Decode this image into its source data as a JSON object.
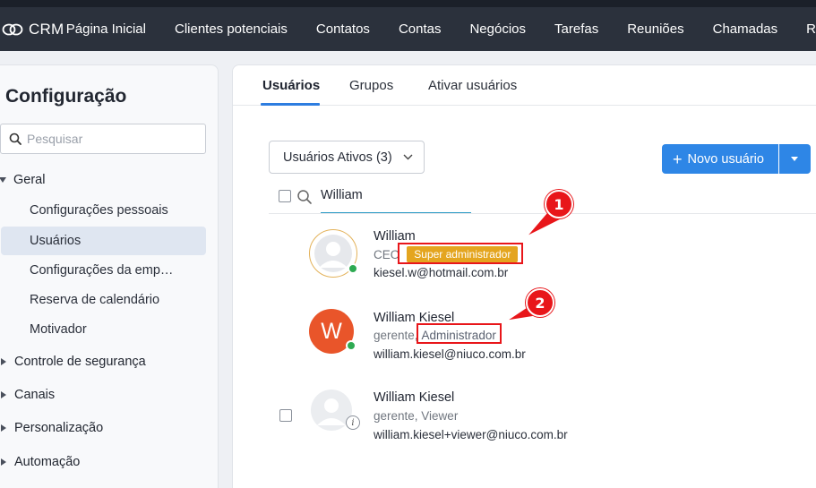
{
  "app": {
    "brand": "CRM"
  },
  "nav": {
    "items": [
      "Página Inicial",
      "Clientes potenciais",
      "Contatos",
      "Contas",
      "Negócios",
      "Tarefas",
      "Reuniões",
      "Chamadas",
      "R"
    ]
  },
  "sidebar": {
    "title": "Configuração",
    "search_placeholder": "Pesquisar",
    "general_label": "Geral",
    "general_items": [
      "Configurações pessoais",
      "Usuários",
      "Configurações da emp…",
      "Reserva de calendário",
      "Motivador"
    ],
    "active_item": "Usuários",
    "groups": [
      "Controle de segurança",
      "Canais",
      "Personalização",
      "Automação"
    ]
  },
  "tabs": [
    "Usuários",
    "Grupos",
    "Ativar usuários"
  ],
  "toolbar": {
    "filter_label": "Usuários Ativos (3)",
    "new_user_label": "Novo usuário",
    "search_value": "William"
  },
  "users": [
    {
      "name": "William",
      "role": "CEO",
      "badge": "Super administrador",
      "email": "kiesel.w@hotmail.com.br",
      "status": "online"
    },
    {
      "name": "William Kiesel",
      "role": "gerente,",
      "badge": "Administrador",
      "email": "william.kiesel@niuco.com.br",
      "initial": "W",
      "status": "online"
    },
    {
      "name": "William Kiesel",
      "role": "gerente, Viewer",
      "email": "william.kiesel+viewer@niuco.com.br",
      "status": "info"
    }
  ],
  "callouts": [
    "1",
    "2"
  ],
  "colors": {
    "nav_bg": "#2b313c",
    "accent_blue": "#2e86e6",
    "super_admin_badge": "#e4a51f",
    "avatar_orange": "#e9552a",
    "online_green": "#2eaa52",
    "annotation_red": "#e8161a"
  },
  "icons": [
    "crm-logo-icon",
    "search-icon",
    "chevron-down-icon",
    "caret-down-icon",
    "caret-right-icon",
    "plus-icon",
    "user-avatar-icon",
    "info-icon"
  ]
}
